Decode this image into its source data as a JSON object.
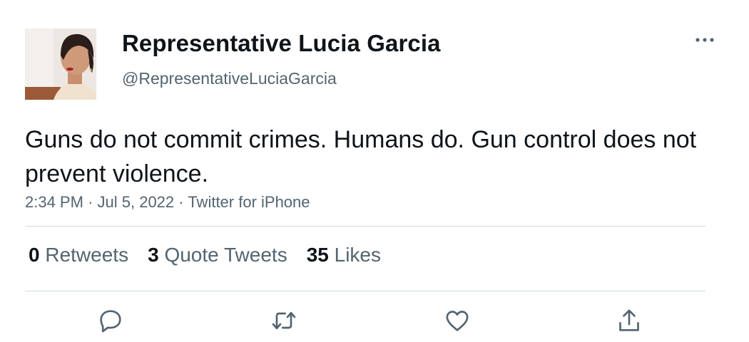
{
  "tweet": {
    "display_name": "Representative Lucia Garcia",
    "handle": "@RepresentativeLuciaGarcia",
    "text": "Guns do not commit crimes. Humans do. Gun control does not prevent violence.",
    "time": "2:34 PM",
    "date": "Jul 5, 2022",
    "source": "Twitter for iPhone",
    "separator": "·"
  },
  "stats": {
    "retweets_count": "0",
    "retweets_label": "Retweets",
    "quotes_count": "3",
    "quotes_label": "Quote Tweets",
    "likes_count": "35",
    "likes_label": "Likes"
  },
  "icons": {
    "more": "more-horizontal-icon",
    "reply": "reply-icon",
    "retweet": "retweet-icon",
    "like": "heart-icon",
    "share": "share-icon"
  },
  "colors": {
    "text_primary": "#0f1419",
    "text_secondary": "#536471",
    "divider": "#cfd9de"
  }
}
